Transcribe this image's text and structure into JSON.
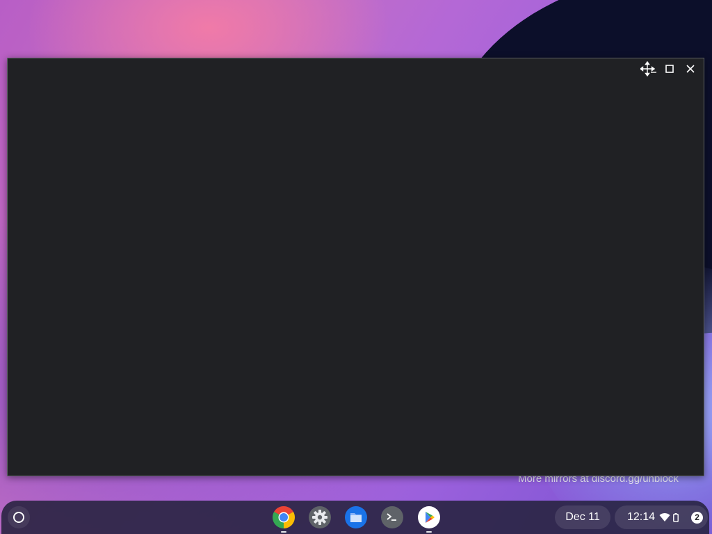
{
  "desktop": {
    "wallpaper_text": "More mirrors at discord.gg/unblock"
  },
  "window": {
    "controls": [
      {
        "icon": "move-icon"
      },
      {
        "icon": "maximize-icon"
      },
      {
        "icon": "close-icon"
      }
    ]
  },
  "shelf": {
    "launcher_icon": "launcher-circle-icon",
    "apps": [
      {
        "name": "Chrome",
        "icon": "chrome-icon",
        "running": true
      },
      {
        "name": "Settings",
        "icon": "settings-gear-icon",
        "running": false
      },
      {
        "name": "Files",
        "icon": "files-folder-icon",
        "running": false
      },
      {
        "name": "Terminal",
        "icon": "terminal-icon",
        "running": false
      },
      {
        "name": "Play Store",
        "icon": "play-store-icon",
        "running": true
      }
    ],
    "date": "Dec 11",
    "time": "12:14",
    "notification_count": "2",
    "colors": {
      "shelf_bg": "#26223e",
      "window_bg": "#202124",
      "chrome_red": "#ea4335",
      "chrome_green": "#34a853",
      "chrome_yellow": "#fbbc04",
      "chrome_blue": "#4285f4",
      "files_blue": "#1a73e8"
    }
  }
}
